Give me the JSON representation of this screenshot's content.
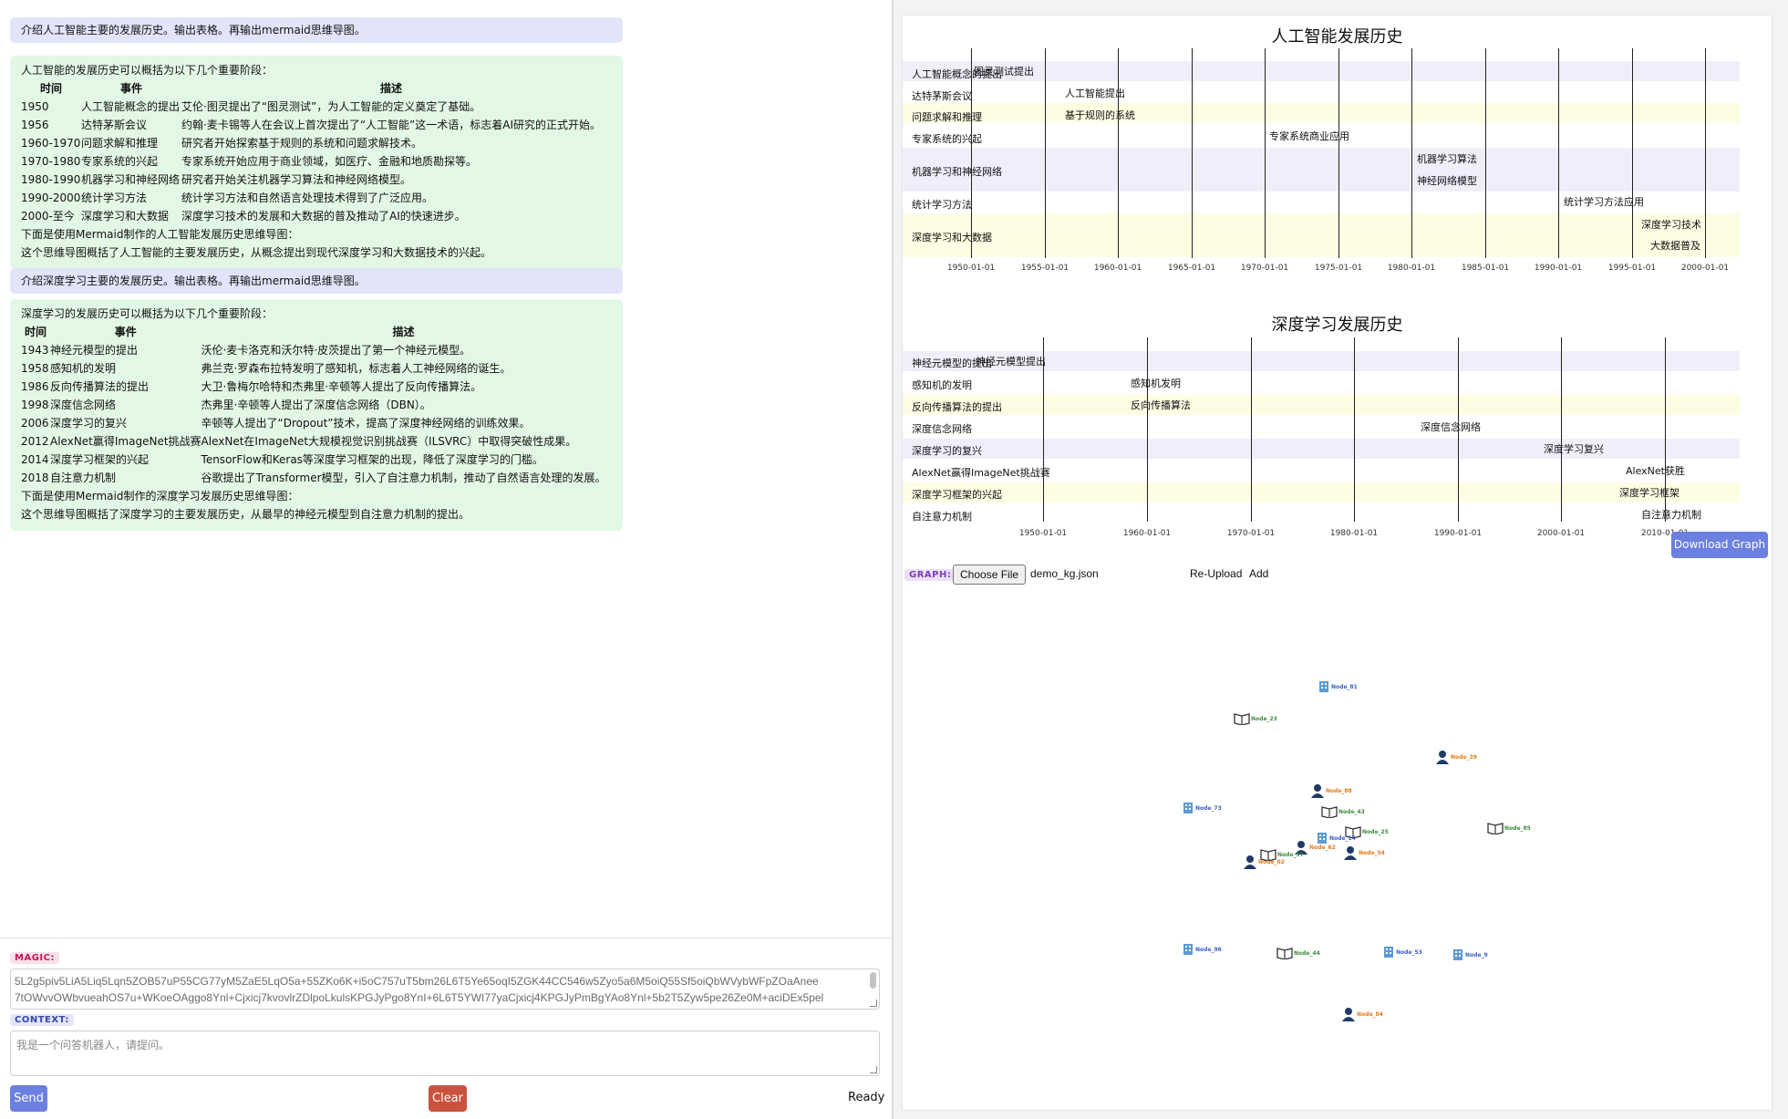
{
  "chat": {
    "q1": "介绍人工智能主要的发展历史。输出表格。再输出mermaid思维导图。",
    "a1": {
      "intro": "人工智能的发展历史可以概括为以下几个重要阶段：",
      "headers": [
        "时间",
        "事件",
        "描述"
      ],
      "rows": [
        [
          "1950",
          "人工智能概念的提出",
          "艾伦·图灵提出了“图灵测试”，为人工智能的定义奠定了基础。"
        ],
        [
          "1956",
          "达特茅斯会议",
          "约翰·麦卡锡等人在会议上首次提出了“人工智能”这一术语，标志着AI研究的正式开始。"
        ],
        [
          "1960-1970",
          "问题求解和推理",
          "研究者开始探索基于规则的系统和问题求解技术。"
        ],
        [
          "1970-1980",
          "专家系统的兴起",
          "专家系统开始应用于商业领域，如医疗、金融和地质勘探等。"
        ],
        [
          "1980-1990",
          "机器学习和神经网络",
          "研究者开始关注机器学习算法和神经网络模型。"
        ],
        [
          "1990-2000",
          "统计学习方法",
          "统计学习方法和自然语言处理技术得到了广泛应用。"
        ],
        [
          "2000-至今",
          "深度学习和大数据",
          "深度学习技术的发展和大数据的普及推动了AI的快速进步。"
        ]
      ],
      "outro1": "下面是使用Mermaid制作的人工智能发展历史思维导图：",
      "outro2": "这个思维导图概括了人工智能的主要发展历史，从概念提出到现代深度学习和大数据技术的兴起。"
    },
    "q2": "介绍深度学习主要的发展历史。输出表格。再输出mermaid思维导图。",
    "a2": {
      "intro": "深度学习的发展历史可以概括为以下几个重要阶段：",
      "headers": [
        "时间",
        "事件",
        "描述"
      ],
      "rows": [
        [
          "1943",
          "神经元模型的提出",
          "沃伦·麦卡洛克和沃尔特·皮茨提出了第一个神经元模型。"
        ],
        [
          "1958",
          "感知机的发明",
          "弗兰克·罗森布拉特发明了感知机，标志着人工神经网络的诞生。"
        ],
        [
          "1986",
          "反向传播算法的提出",
          "大卫·鲁梅尔哈特和杰弗里·辛顿等人提出了反向传播算法。"
        ],
        [
          "1998",
          "深度信念网络",
          "杰弗里·辛顿等人提出了深度信念网络（DBN）。"
        ],
        [
          "2006",
          "深度学习的复兴",
          "辛顿等人提出了“Dropout”技术，提高了深度神经网络的训练效果。"
        ],
        [
          "2012",
          "AlexNet赢得ImageNet挑战赛",
          "AlexNet在ImageNet大规模视觉识别挑战赛（ILSVRC）中取得突破性成果。"
        ],
        [
          "2014",
          "深度学习框架的兴起",
          "TensorFlow和Keras等深度学习框架的出现，降低了深度学习的门槛。"
        ],
        [
          "2018",
          "自注意力机制",
          "谷歌提出了Transformer模型，引入了自注意力机制，推动了自然语言处理的发展。"
        ]
      ],
      "outro1": "下面是使用Mermaid制作的深度学习发展历史思维导图：",
      "outro2": "这个思维导图概括了深度学习的主要发展历史，从最早的神经元模型到自注意力机制的提出。"
    }
  },
  "input": {
    "magic_label": "MAGIC:",
    "magic_line1": "5L2g5piv5LiA5Liq5Lqn5ZOB57uP55CG77yM5ZaE5LqO5a+55ZKo6K+i5oC757uT5bm26L6T5Ye65oqI5ZGK44CC546w5Zyo5a6M5oiQ55Sf5oiQbWVybWFpZOaAnee",
    "magic_line2": "7tOWvvOWbvueahOS7u+WKoeOAggo8Ynl+Cjxicj7kvovlrZDlpoLkulsKPGJyPgo8YnI+6L6T5YWI77yaCjxicj4KPGJyPmBgYAo8Ynl+5b2T5Zyw5pe26Ze0M+aciDEx5pel",
    "context_label": "CONTEXT:",
    "context_placeholder": "我是一个问答机器人，请提问。",
    "send_label": "Send",
    "clear_label": "Clear",
    "status": "Ready"
  },
  "gantt1": {
    "title": "人工智能发展历史",
    "sections": [
      "人工智能概念的提出",
      "达特茅斯会议",
      "问题求解和推理",
      "专家系统的兴起",
      "机器学习和神经网络",
      "统计学习方法",
      "深度学习和大数据"
    ],
    "tasks": [
      "图灵测试提出",
      "人工智能提出",
      "基于规则的系统",
      "专家系统商业应用",
      "机器学习算法",
      "神经网络模型",
      "统计学习方法应用",
      "深度学习技术",
      "大数据普及"
    ],
    "ticks": [
      "1950-01-01",
      "1955-01-01",
      "1960-01-01",
      "1965-01-01",
      "1970-01-01",
      "1975-01-01",
      "1980-01-01",
      "1985-01-01",
      "1990-01-01",
      "1995-01-01",
      "2000-01-01"
    ]
  },
  "gantt2": {
    "title": "深度学习发展历史",
    "sections": [
      "神经元模型的提出",
      "感知机的发明",
      "反向传播算法的提出",
      "深度信念网络",
      "深度学习的复兴",
      "AlexNet赢得ImageNet挑战赛",
      "深度学习框架的兴起",
      "自注意力机制"
    ],
    "tasks": [
      "神经元模型提出",
      "感知机发明",
      "反向传播算法",
      "深度信念网络",
      "深度学习复兴",
      "AlexNet获胜",
      "深度学习框架",
      "自注意力机制"
    ],
    "ticks": [
      "1950-01-01",
      "1960-01-01",
      "1970-01-01",
      "1980-01-01",
      "1990-01-01",
      "2000-01-01",
      "2010-01-01"
    ]
  },
  "graph": {
    "download_label": "Download Graph",
    "tag": "GRAPH:",
    "choose_file_label": "Choose File",
    "file_name": "demo_kg.json",
    "reupload_label": "Re-Upload",
    "add_label": "Add",
    "nodes": [
      "Node_81",
      "Node_23",
      "Node_39",
      "Node_88",
      "Node_73",
      "Node_43",
      "Node_25",
      "Node_85",
      "Node_62",
      "Node_54",
      "Node_14",
      "Node_02",
      "Node_97",
      "Node_96",
      "Node_44",
      "Node_53",
      "Node_9",
      "Node_84"
    ],
    "colors": {
      "person": "#1f3a66",
      "building": "#5b9bd5",
      "book": "#333333",
      "orange": "#e07b1a",
      "green": "#3d8c3d",
      "blue": "#3b5fc4"
    }
  }
}
